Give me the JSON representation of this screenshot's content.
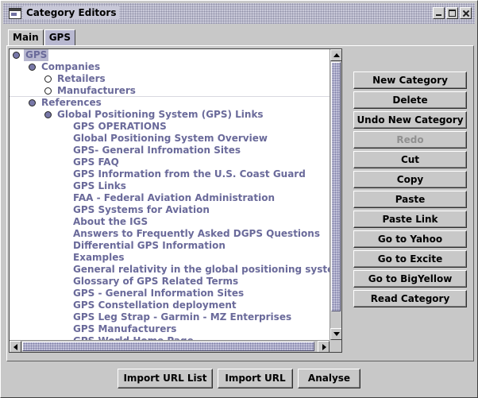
{
  "window": {
    "title": "Category Editors"
  },
  "tabs": [
    {
      "label": "Main",
      "active": false
    },
    {
      "label": "GPS",
      "active": true
    }
  ],
  "tree": {
    "items": [
      {
        "label": "GPS",
        "level": 0,
        "icon": "folder-node",
        "selected": true
      },
      {
        "label": "Companies",
        "level": 1,
        "icon": "folder-node"
      },
      {
        "label": "Retailers",
        "level": 2,
        "icon": "leaf-node"
      },
      {
        "label": "Manufacturers",
        "level": 2,
        "icon": "leaf-node"
      },
      {
        "label": "References",
        "level": 1,
        "icon": "folder-node"
      },
      {
        "label": "Global Positioning System (GPS) Links",
        "level": 2,
        "icon": "folder-node"
      },
      {
        "label": "GPS OPERATIONS",
        "level": 3
      },
      {
        "label": "Global Positioning System Overview",
        "level": 3
      },
      {
        "label": "GPS- General Infromation Sites",
        "level": 3
      },
      {
        "label": "GPS FAQ",
        "level": 3
      },
      {
        "label": "GPS Information from the U.S. Coast Guard",
        "level": 3
      },
      {
        "label": "GPS Links",
        "level": 3
      },
      {
        "label": "FAA - Federal Aviation Administration",
        "level": 3
      },
      {
        "label": "GPS Systems for Aviation",
        "level": 3
      },
      {
        "label": "About the IGS",
        "level": 3
      },
      {
        "label": "Answers to Frequently Asked DGPS Questions",
        "level": 3
      },
      {
        "label": "Differential GPS Information",
        "level": 3
      },
      {
        "label": "Examples",
        "level": 3
      },
      {
        "label": "General relativity in the global positioning system",
        "level": 3
      },
      {
        "label": "Glossary of GPS Related Terms",
        "level": 3
      },
      {
        "label": "GPS - General Information Sites",
        "level": 3
      },
      {
        "label": "GPS Constellation deployment",
        "level": 3
      },
      {
        "label": "GPS Leg Strap - Garmin - MZ Enterprises",
        "level": 3
      },
      {
        "label": "GPS Manufacturers",
        "level": 3
      },
      {
        "label": "GPS World Home Page",
        "level": 3
      }
    ]
  },
  "side_buttons": [
    {
      "label": "New Category",
      "enabled": true
    },
    {
      "label": "Delete",
      "enabled": true
    },
    {
      "label": "Undo New Category",
      "enabled": true
    },
    {
      "label": "Redo",
      "enabled": false
    },
    {
      "label": "Cut",
      "enabled": true
    },
    {
      "label": "Copy",
      "enabled": true
    },
    {
      "label": "Paste",
      "enabled": true
    },
    {
      "label": "Paste Link",
      "enabled": true
    },
    {
      "label": "Go to Yahoo",
      "enabled": true
    },
    {
      "label": "Go to Excite",
      "enabled": true
    },
    {
      "label": "Go to BigYellow",
      "enabled": true
    },
    {
      "label": "Read Category",
      "enabled": true
    }
  ],
  "bottom_buttons": {
    "import_list": "Import URL List",
    "import_url": "Import URL",
    "analyse": "Analyse"
  },
  "colors": {
    "tree_text": "#6a6a9a",
    "selection": "#b8b8d0",
    "background": "#c8c8c8"
  }
}
